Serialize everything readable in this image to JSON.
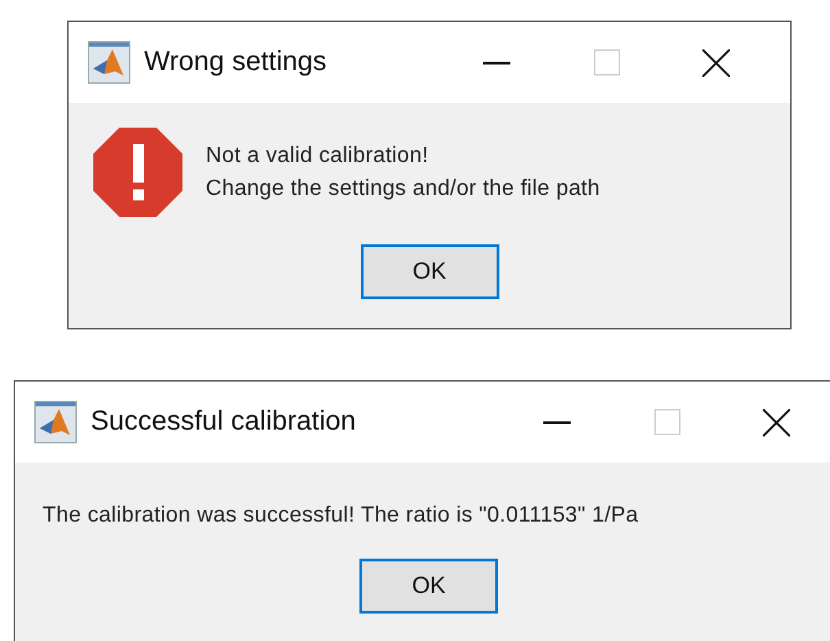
{
  "dialogs": [
    {
      "title": "Wrong settings",
      "kind": "error",
      "maximize_disabled": true,
      "message": [
        "Not a valid calibration!",
        "Change the settings and/or the file path"
      ],
      "button": {
        "label": "OK",
        "default": true
      }
    },
    {
      "title": "Successful calibration",
      "kind": "plain",
      "maximize_disabled": true,
      "message": [
        "The calibration was successful! The ratio is \"0.011153\" 1/Pa"
      ],
      "button": {
        "label": "OK",
        "default": true
      }
    }
  ]
}
